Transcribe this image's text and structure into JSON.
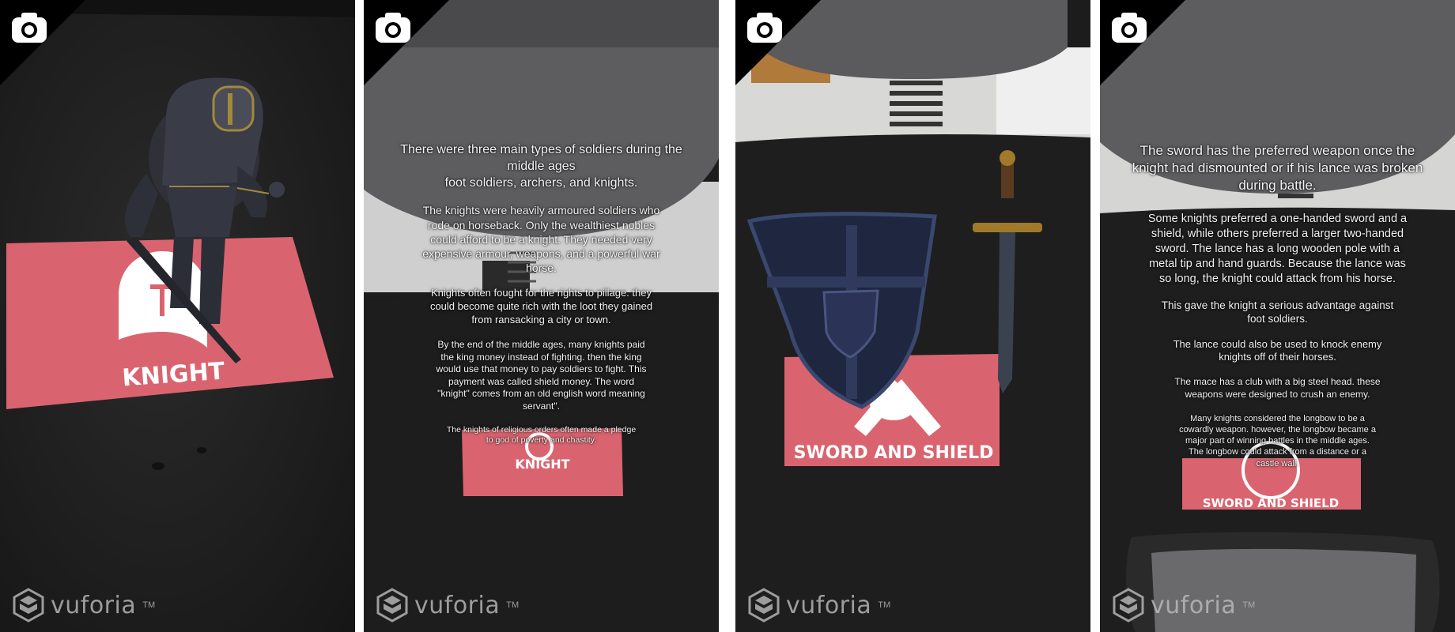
{
  "panels": [
    {
      "marker": {
        "label": "KNIGHT"
      },
      "watermark": {
        "brand": "vuforia",
        "tm": "TM"
      }
    },
    {
      "marker": {
        "label": "KNIGHT"
      },
      "watermark": {
        "brand": "vuforia",
        "tm": "TM"
      },
      "info": [
        "There were three main types of soldiers during the\nmiddle ages\nfoot soldiers, archers, and knights.",
        "The knights were heavily armoured soldiers who\nrode on horseback. Only the wealthiest nobles\ncould afford to be a knight. They needed very\nexpensive armour, weapons, and a powerful war\nhorse.",
        "Knights often fought for the rights to pillage. they\ncould become quite rich with the loot they gained\nfrom ransacking a city or town.",
        "By the end of the middle ages, many knights paid\nthe king money instead of fighting. then the king\nwould use that money to pay soldiers to fight. This\npayment was called shield money. The word\n\"knight\" comes from an old english word meaning\nservant\".",
        "The knights of religious orders often made a pledge\nto god of poverty and chastity."
      ]
    },
    {
      "marker": {
        "label": "SWORD AND SHIELD"
      },
      "watermark": {
        "brand": "vuforia",
        "tm": "TM"
      }
    },
    {
      "marker": {
        "label": "SWORD AND SHIELD"
      },
      "watermark": {
        "brand": "vuforia",
        "tm": "TM"
      },
      "info": [
        "The sword has the preferred weapon once the\nknight had dismounted or if his lance was broken\nduring battle.",
        "Some knights preferred a one-handed sword and a\nshield, while others preferred a larger two-handed\nsword. The lance has a long wooden pole with a\nmetal tip and hand guards. Because the lance was\nso long, the knight could attack from his horse.",
        "This gave the knight a serious advantage against\nfoot soldiers.",
        "The lance could also be used to knock enemy\nknights off of their horses.",
        "The mace has a club with a big steel head. these\nweapons were designed to crush an enemy.",
        "Many knights considered the longbow to be a\ncowardly weapon. however, the longbow became a\nmajor part of winning battles in the middle ages.\nThe longbow could attack from a distance or a\ncastle wall."
      ]
    }
  ],
  "colors": {
    "marker": "#d9646f",
    "marker_text": "#ffffff",
    "fabric_dark": "#1f1f1f",
    "chair_grey": "#5f5f63"
  },
  "icons": {
    "camera": "camera-icon",
    "watermark": "vuforia-logo-icon"
  }
}
